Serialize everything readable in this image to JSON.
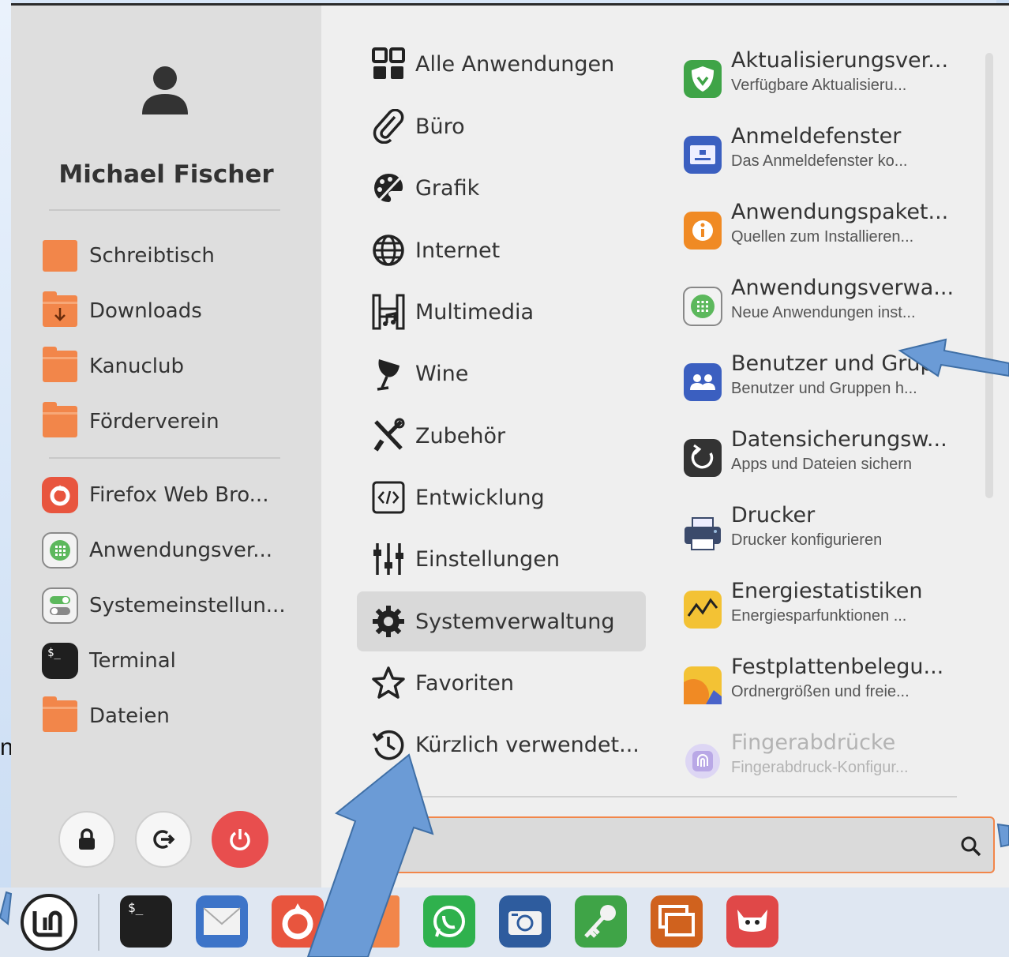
{
  "background": {
    "partial_text": "nt"
  },
  "user": {
    "name": "Michael Fischer"
  },
  "places": [
    {
      "label": "Schreibtisch",
      "icon": "desktop-folder-icon"
    },
    {
      "label": "Downloads",
      "icon": "downloads-folder-icon"
    },
    {
      "label": "Kanuclub",
      "icon": "folder-icon"
    },
    {
      "label": "Förderverein",
      "icon": "folder-icon"
    }
  ],
  "favorites": [
    {
      "label": "Firefox Web Bro...",
      "icon": "firefox-icon"
    },
    {
      "label": "Anwendungsver...",
      "icon": "software-manager-icon"
    },
    {
      "label": "Systemeinstellun...",
      "icon": "system-settings-icon"
    },
    {
      "label": "Terminal",
      "icon": "terminal-icon"
    },
    {
      "label": "Dateien",
      "icon": "files-folder-icon"
    }
  ],
  "session_buttons": [
    "lock-icon",
    "logout-icon",
    "power-icon"
  ],
  "categories": [
    {
      "label": "Alle Anwendungen",
      "icon": "all-apps-icon"
    },
    {
      "label": "Büro",
      "icon": "paperclip-icon"
    },
    {
      "label": "Grafik",
      "icon": "graphics-icon"
    },
    {
      "label": "Internet",
      "icon": "globe-icon"
    },
    {
      "label": "Multimedia",
      "icon": "multimedia-icon"
    },
    {
      "label": "Wine",
      "icon": "wine-icon"
    },
    {
      "label": "Zubehör",
      "icon": "tools-icon"
    },
    {
      "label": "Entwicklung",
      "icon": "code-icon"
    },
    {
      "label": "Einstellungen",
      "icon": "sliders-icon"
    },
    {
      "label": "Systemverwaltung",
      "icon": "gear-icon",
      "active": true
    },
    {
      "label": "Favoriten",
      "icon": "star-icon"
    },
    {
      "label": "Kürzlich verwendet...",
      "icon": "history-icon"
    }
  ],
  "apps": [
    {
      "name": "Aktualisierungsver...",
      "desc": "Verfügbare Aktualisieru...",
      "icon": "update-shield-icon",
      "color": "#3fa447"
    },
    {
      "name": "Anmeldefenster",
      "desc": "Das Anmeldefenster ko...",
      "icon": "login-window-icon",
      "color": "#3b5fc0"
    },
    {
      "name": "Anwendungspaket...",
      "desc": "Quellen zum Installieren...",
      "icon": "info-icon",
      "color": "#f08a24"
    },
    {
      "name": "Anwendungsverwa...",
      "desc": "Neue Anwendungen inst...",
      "icon": "software-manager-icon",
      "color": "#5cb85c"
    },
    {
      "name": "Benutzer und Grup",
      "desc": "Benutzer und Gruppen h...",
      "icon": "users-icon",
      "color": "#3b5fc0"
    },
    {
      "name": "Datensicherungsw...",
      "desc": "Apps und Dateien sichern",
      "icon": "backup-icon",
      "color": "#333333"
    },
    {
      "name": "Drucker",
      "desc": "Drucker konfigurieren",
      "icon": "printer-icon",
      "color": "#3b4a6b"
    },
    {
      "name": "Energiestatistiken",
      "desc": "Energiesparfunktionen ...",
      "icon": "power-stats-icon",
      "color": "#f3c234"
    },
    {
      "name": "Festplattenbelegu...",
      "desc": "Ordnergrößen und freie...",
      "icon": "disk-usage-icon",
      "color": "#f08a24"
    },
    {
      "name": "Fingerabdrücke",
      "desc": "Fingerabdruck-Konfigur...",
      "icon": "fingerprint-icon",
      "color": "#b9a8e6",
      "faded": true
    }
  ],
  "search": {
    "value": "",
    "placeholder": ""
  },
  "taskbar": [
    "mint-menu-icon",
    "terminal-icon",
    "mail-icon",
    "firefox-icon",
    "files-folder-icon",
    "whatsapp-icon",
    "screenshot-icon",
    "password-key-icon",
    "window-manager-icon",
    "gimp-icon"
  ]
}
